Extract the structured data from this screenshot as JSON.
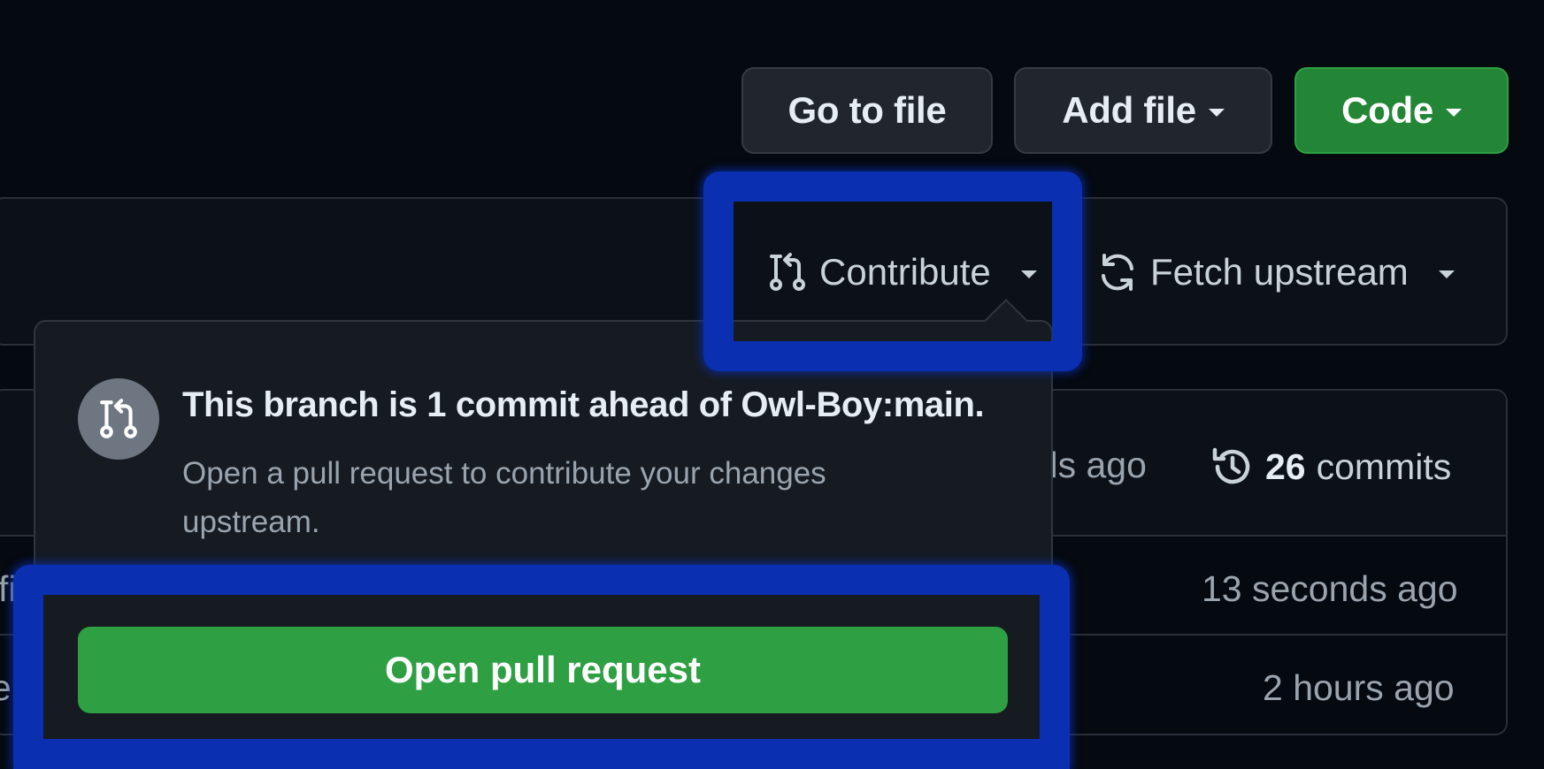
{
  "header_actions": {
    "go_to_file": "Go to file",
    "add_file": "Add file",
    "code": "Code"
  },
  "fork_bar": {
    "contribute_label": "Contribute",
    "fetch_upstream_label": "Fetch upstream"
  },
  "commit_table": {
    "last_commit_time_fragment": "nds ago",
    "commits_count": "26",
    "commits_label": "commits",
    "rows": [
      {
        "name_fragment": "fil",
        "time": "13 seconds ago"
      },
      {
        "name_fragment": "e s",
        "time": "2 hours ago"
      }
    ]
  },
  "contribute_popover": {
    "title": "This branch is 1 commit ahead of Owl-Boy:main.",
    "description": "Open a pull request to contribute your changes upstream.",
    "open_pr_button": "Open pull request"
  },
  "colors": {
    "background": "#050910",
    "primary_green": "#238636",
    "open_pr_green": "#2ea043",
    "highlight_blue": "#0a2fb0"
  },
  "icons": [
    "triangle-down-icon",
    "git-pull-request-icon",
    "sync-icon",
    "history-icon"
  ]
}
